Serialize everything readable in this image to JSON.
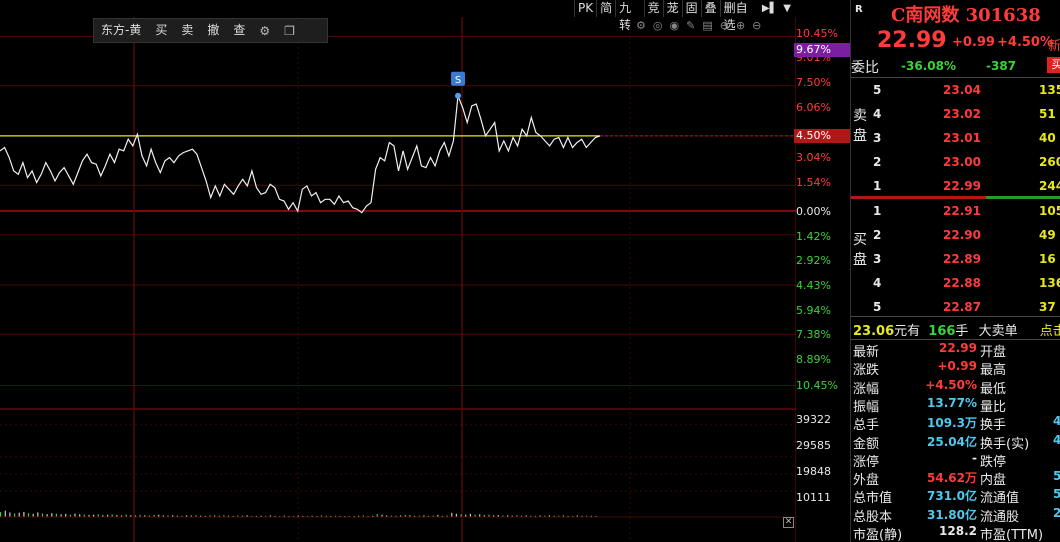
{
  "toolbar_top": {
    "items": [
      "PK",
      "简",
      "九转",
      "竞",
      "茏",
      "固",
      "叠",
      "删自选"
    ],
    "panel_toggle_icon": "panel-collapse-icon",
    "dropdown_icon": "triangle-down-icon"
  },
  "float_toolbar": {
    "broker": "东方-黄",
    "buy": "买",
    "sell": "卖",
    "cancel": "撤",
    "query": "查",
    "settings_icon": "gear-icon",
    "window_icon": "window-icon"
  },
  "chart_icons": [
    "settings-gear-icon",
    "eye-hidden-icon",
    "eye-icon",
    "pen-icon",
    "trash-icon",
    "minus-icon",
    "plus-icon",
    "zoom-out-icon"
  ],
  "marker": {
    "label": "S"
  },
  "y_axis_left_pct": [
    {
      "label": "10.45%",
      "color": "#ff3b3b"
    },
    {
      "label": "9.01%",
      "color": "#ff3b3b"
    },
    {
      "label": "7.50%",
      "color": "#ff3b3b"
    },
    {
      "label": "6.06%",
      "color": "#ff3b3b"
    },
    {
      "label": "3.04%",
      "color": "#ff3b3b"
    },
    {
      "label": "1.54%",
      "color": "#ff3b3b"
    },
    {
      "label": "0.00%",
      "color": "#e8e8e8"
    },
    {
      "label": "1.42%",
      "color": "#3bd23b"
    },
    {
      "label": "2.92%",
      "color": "#3bd23b"
    },
    {
      "label": "4.43%",
      "color": "#3bd23b"
    },
    {
      "label": "5.94%",
      "color": "#3bd23b"
    },
    {
      "label": "7.38%",
      "color": "#3bd23b"
    },
    {
      "label": "8.89%",
      "color": "#3bd23b"
    },
    {
      "label": "10.45%",
      "color": "#3bd23b"
    }
  ],
  "highlight_labels": {
    "upper": {
      "label": "9.67%",
      "color": "#7a1fa0"
    },
    "current": {
      "label": "4.50%",
      "color": "#b01818"
    }
  },
  "volume_axis": [
    "39322",
    "29585",
    "19848",
    "10111"
  ],
  "panel": {
    "r_mark": "R",
    "name": "C南网数 301638",
    "price": "22.99",
    "change": "+0.99",
    "change_pct": "+4.50%",
    "new_tag": "新",
    "weibi_label": "委比",
    "weibi_pct": "-36.08%",
    "weibi_diff": "-387",
    "buy_tag": "买",
    "sell_side_label": "卖盘",
    "buy_side_label": "买盘",
    "sell_book": [
      {
        "level": "5",
        "price": "23.04",
        "vol": "135"
      },
      {
        "level": "4",
        "price": "23.02",
        "vol": "51"
      },
      {
        "level": "3",
        "price": "23.01",
        "vol": "40"
      },
      {
        "level": "2",
        "price": "23.00",
        "vol": "260"
      },
      {
        "level": "1",
        "price": "22.99",
        "vol": "244"
      }
    ],
    "buy_book": [
      {
        "level": "1",
        "price": "22.91",
        "vol": "105"
      },
      {
        "level": "2",
        "price": "22.90",
        "vol": "49"
      },
      {
        "level": "3",
        "price": "22.89",
        "vol": "16"
      },
      {
        "level": "4",
        "price": "22.88",
        "vol": "136"
      },
      {
        "level": "5",
        "price": "22.87",
        "vol": "37"
      }
    ],
    "trade_line": {
      "price": "23.06",
      "unit": "元有",
      "qty": "166",
      "qty_unit": "手",
      "type": "大卖单",
      "extra": "点击"
    },
    "stats": [
      {
        "l1": "最新",
        "v1": "22.99",
        "c1": "red",
        "l2": "开盘",
        "v2": ""
      },
      {
        "l1": "涨跌",
        "v1": "+0.99",
        "c1": "red",
        "l2": "最高",
        "v2": ""
      },
      {
        "l1": "涨幅",
        "v1": "+4.50%",
        "c1": "red",
        "l2": "最低",
        "v2": ""
      },
      {
        "l1": "振幅",
        "v1": "13.77%",
        "c1": "cyan",
        "l2": "量比",
        "v2": ""
      },
      {
        "l1": "总手",
        "v1": "109.3万",
        "c1": "cyan",
        "l2": "换手",
        "v2": "4"
      },
      {
        "l1": "金额",
        "v1": "25.04亿",
        "c1": "cyan",
        "l2": "换手(实)",
        "v2": "4"
      },
      {
        "l1": "涨停",
        "v1": "-",
        "c1": "white",
        "l2": "跌停",
        "v2": ""
      },
      {
        "l1": "外盘",
        "v1": "54.62万",
        "c1": "red",
        "l2": "内盘",
        "v2": "5"
      },
      {
        "l1": "总市值",
        "v1": "731.0亿",
        "c1": "cyan",
        "l2": "流通值",
        "v2": "5"
      },
      {
        "l1": "总股本",
        "v1": "31.80亿",
        "c1": "cyan",
        "l2": "流通股",
        "v2": "2"
      },
      {
        "l1": "市盈(静)",
        "v1": "128.2",
        "c1": "white",
        "l2": "市盈(TTM)",
        "v2": ""
      }
    ]
  },
  "chart_data": {
    "type": "line",
    "y_unit": "%",
    "ylim": [
      -10.45,
      10.45
    ],
    "avg_line_pct": 4.5,
    "series": [
      {
        "values": [
          3.6,
          3.8,
          3.2,
          2.4,
          2.2,
          2.9,
          2.0,
          2.4,
          1.7,
          2.2,
          2.9,
          2.4,
          1.8,
          2.3,
          2.6,
          2.1,
          1.6,
          2.3,
          3.0,
          3.4,
          2.9,
          2.8,
          2.1,
          2.7,
          3.4,
          2.9,
          3.7,
          3.6,
          4.3,
          3.9,
          4.6,
          3.3,
          2.7,
          3.7,
          2.9,
          2.3,
          3.0,
          3.2,
          2.9,
          3.3,
          3.5,
          3.6,
          3.7,
          3.4,
          2.6,
          1.8,
          0.8,
          1.5,
          0.9,
          1.6,
          1.3,
          1.0,
          1.5,
          1.9,
          1.5,
          2.4,
          1.4,
          1.0,
          1.1,
          1.6,
          1.4,
          0.7,
          0.6,
          0.1,
          0.5,
          0.0,
          1.3,
          1.5,
          0.9,
          1.1,
          0.5,
          0.7,
          0.7,
          0.4,
          0.9,
          0.5,
          0.6,
          0.2,
          0.1,
          -0.1,
          0.3,
          0.5,
          2.5,
          3.2,
          3.0,
          4.1,
          3.9,
          2.4,
          3.6,
          2.5,
          3.2,
          3.9,
          2.7,
          2.6,
          3.2,
          2.7,
          3.6,
          4.1,
          3.3,
          4.2,
          6.9,
          6.2,
          5.3,
          6.3,
          6.4,
          5.5,
          4.5,
          4.9,
          5.3,
          3.6,
          4.2,
          3.6,
          4.4,
          3.9,
          4.9,
          4.5,
          5.6,
          4.7,
          4.5,
          4.2,
          3.9,
          4.3,
          4.4,
          3.8,
          4.4,
          3.8,
          4.1,
          4.3,
          3.8,
          4.1,
          4.4,
          4.5
        ]
      }
    ],
    "volume": [
      4000,
      5200,
      3800,
      2900,
      3500,
      4200,
      3100,
      2600,
      3800,
      2900,
      2400,
      3100,
      2700,
      2200,
      2500,
      1900,
      2800,
      2300,
      2000,
      1700,
      1900,
      2200,
      1500,
      1800,
      2100,
      1600,
      1300,
      1900,
      1500,
      1200,
      1700,
      1400,
      1100,
      1600,
      1800,
      1300,
      1200,
      1500,
      1100,
      1000,
      1400,
      1200,
      1500,
      1100,
      900,
      1300,
      1200,
      1000,
      1500,
      1100,
      800,
      1200,
      1000,
      1400,
      900,
      800,
      1100,
      900,
      1300,
      1000,
      700,
      1100,
      800,
      900,
      1200,
      700,
      600,
      1000,
      800,
      1300,
      900,
      700,
      1100,
      800,
      600,
      900,
      700,
      1000,
      1200,
      800,
      900,
      2400,
      1800,
      1300,
      1100,
      1000,
      1200,
      1600,
      1400,
      900,
      1100,
      1300,
      800,
      1100,
      1700,
      900,
      1200,
      3400,
      2600,
      2100,
      1900,
      2600,
      1800,
      2200,
      1500,
      1900,
      1300,
      1600,
      1200,
      1400,
      1100,
      1500,
      1000,
      1300,
      1100,
      900,
      1200,
      1000,
      1400,
      900,
      1100,
      1200,
      800,
      1000,
      1300,
      900,
      1100,
      1000,
      800
    ]
  }
}
